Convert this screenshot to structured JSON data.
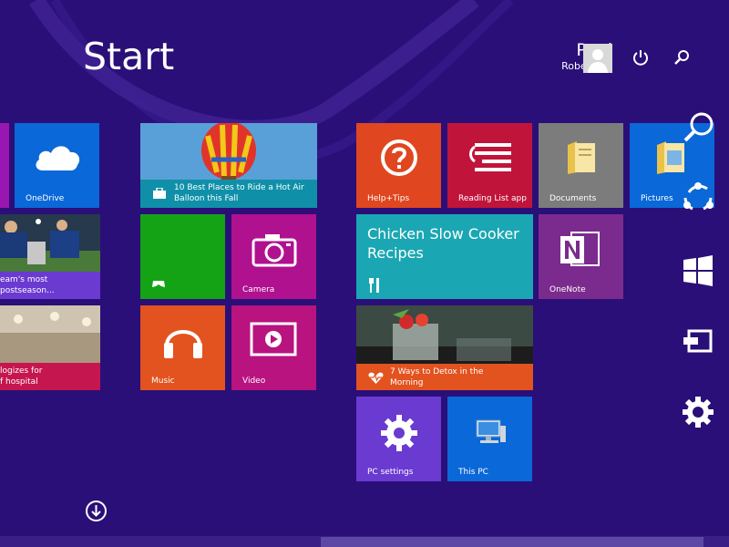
{
  "start": {
    "title": "Start"
  },
  "user": {
    "first_name": "Paul",
    "last_name": "Robertson"
  },
  "icons": {
    "power": "power-icon",
    "search": "search-icon",
    "down": "arrow-down-circle-icon"
  },
  "tiles": {
    "left_edge_tile_1": {
      "color": "#9a16b2"
    },
    "onedrive": {
      "label": "OneDrive",
      "color": "#0a68d8"
    },
    "sports": {
      "caption": "eam's most\npostseason...",
      "color": "#6a3ad1"
    },
    "news_hospital": {
      "caption": "logizes for\nf hospital",
      "color": "#c6164f"
    },
    "travel": {
      "caption": "10 Best Places to Ride a Hot Air Balloon this Fall",
      "color": "#0f90a8"
    },
    "xbox": {
      "color": "#14a314"
    },
    "camera": {
      "label": "Camera",
      "color": "#b0118f"
    },
    "music": {
      "label": "Music",
      "color": "#e2531f"
    },
    "video": {
      "label": "Video",
      "color": "#b8137f"
    },
    "help": {
      "label": "Help+Tips",
      "color": "#e0461f"
    },
    "reading": {
      "label": "Reading List app",
      "color": "#c1143b"
    },
    "documents": {
      "label": "Documents",
      "color": "#7c7c7c"
    },
    "pictures": {
      "label": "Pictures",
      "color": "#0a68d8"
    },
    "food": {
      "title": "Chicken Slow Cooker Recipes",
      "color": "#1aa7b3"
    },
    "onenote": {
      "label": "OneNote",
      "color": "#7b2b8e"
    },
    "health": {
      "caption": "7 Ways to Detox in the Morning",
      "color": "#e2531f"
    },
    "pc_settings": {
      "label": "PC settings",
      "color": "#6a3ad1"
    },
    "this_pc": {
      "label": "This PC",
      "color": "#0a68d8"
    }
  },
  "charms": [
    "search-charm-icon",
    "share-charm-icon",
    "start-charm-icon",
    "devices-charm-icon",
    "settings-charm-icon"
  ]
}
